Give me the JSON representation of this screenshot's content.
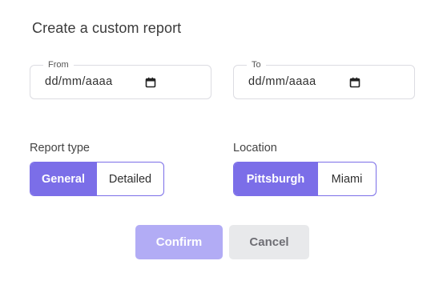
{
  "dialog": {
    "title": "Create a custom report"
  },
  "date_range": {
    "from": {
      "legend": "From",
      "value": "dd/mm/aaaa",
      "icon": "calendar-icon"
    },
    "to": {
      "legend": "To",
      "value": "dd/mm/aaaa",
      "icon": "calendar-icon"
    }
  },
  "report_type": {
    "label": "Report type",
    "options": [
      "General",
      "Detailed"
    ],
    "selected": "General"
  },
  "location": {
    "label": "Location",
    "options": [
      "Pittsburgh",
      "Miami"
    ],
    "selected": "Pittsburgh"
  },
  "actions": {
    "confirm_label": "Confirm",
    "cancel_label": "Cancel"
  },
  "colors": {
    "accent": "#7b6ee8",
    "confirm_disabled": "#b2acf5",
    "cancel_bg": "#e8e9eb"
  }
}
